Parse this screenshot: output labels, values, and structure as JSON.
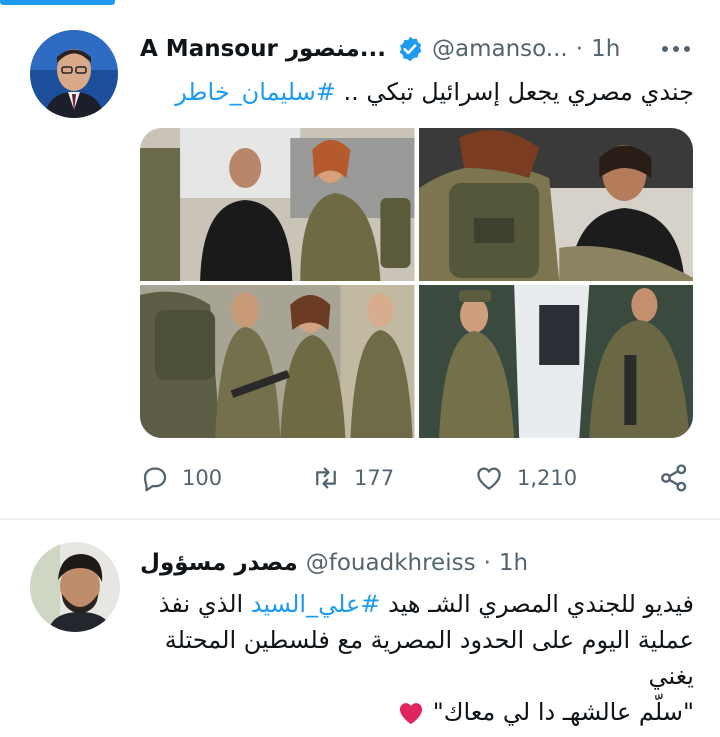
{
  "tweets": [
    {
      "name": "A Mansour منصور...",
      "handle": "@amanso...",
      "separator": "·",
      "time": "1h",
      "text_plain": "جندي مصري يجعل إسرائيل تبكي ..",
      "text_tag": "#سليمان_خاطر",
      "actions": {
        "replies": "100",
        "retweets": "177",
        "likes": "1,210"
      },
      "images": [
        {
          "icon": "photo-crying-woman-and-soldier"
        },
        {
          "icon": "photo-soldiers-embracing"
        },
        {
          "icon": "photo-group-of-soldiers"
        },
        {
          "icon": "photo-soldier-at-car-door"
        }
      ]
    },
    {
      "name": "مصدر مسؤول",
      "handle": "@fouadkhreiss",
      "separator": "·",
      "time": "1h",
      "line1_pre": "فيديو للجندي المصري الشـ هيد",
      "line1_tag": "#علي_السيد",
      "line1_post": "الذي نفذ",
      "line2": "عملية اليوم على الحدود المصرية مع فلسطين المحتلة يغني",
      "line3": "\"سلّم عالشهـ دا لي معاك\""
    }
  ],
  "colors": {
    "accent": "#1d9bf0",
    "muted": "#536471",
    "heart": "#e0245e"
  }
}
